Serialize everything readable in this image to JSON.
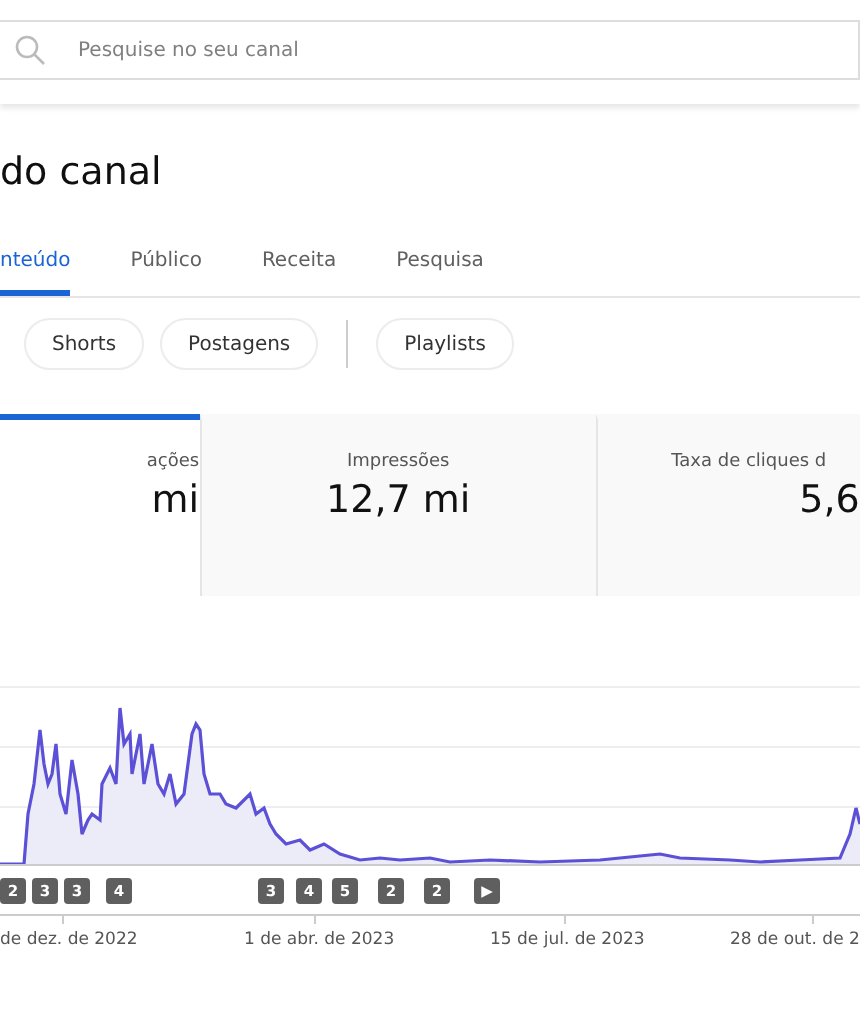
{
  "search": {
    "placeholder": "Pesquise no seu canal"
  },
  "page_title": "do canal",
  "tabs": [
    {
      "label": "nteúdo",
      "selected": true
    },
    {
      "label": "Público",
      "selected": false
    },
    {
      "label": "Receita",
      "selected": false
    },
    {
      "label": "Pesquisa",
      "selected": false
    }
  ],
  "chips": [
    {
      "label": "Shorts"
    },
    {
      "label": "Postagens"
    },
    {
      "kind": "divider"
    },
    {
      "label": "Playlists"
    }
  ],
  "metrics": [
    {
      "label": "ações",
      "value": "mi",
      "selected": true
    },
    {
      "label": "Impressões",
      "value": "12,7 mi",
      "selected": false
    },
    {
      "label": "Taxa de cliques d",
      "value": "5,6",
      "selected": false
    }
  ],
  "chart": {
    "markers": [
      "2",
      "3",
      "3",
      "4",
      "3",
      "4",
      "5",
      "2",
      "2",
      "▶"
    ],
    "x_labels": [
      "de dez. de 2022",
      "1 de abr. de 2023",
      "15 de jul. de 2023",
      "28 de out. de 2"
    ]
  }
}
